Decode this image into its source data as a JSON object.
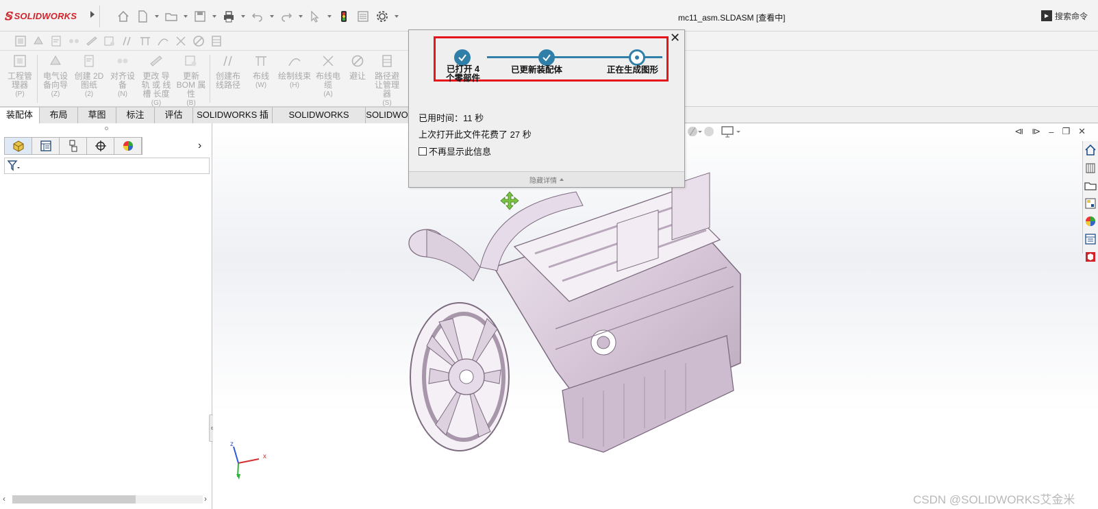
{
  "app": {
    "logo_mark": "𝕊",
    "logo_text": "SOLIDWORKS",
    "document_title": "mc11_asm.SLDASM [查看中]",
    "search_label": "搜索命令",
    "search_icon_glyph": "▶"
  },
  "command_manager": {
    "items": [
      {
        "label": "工程管理器",
        "shortcut": "(P)"
      },
      {
        "label": "电气设备向导",
        "shortcut": "(Z)"
      },
      {
        "label": "创建 2D 图纸",
        "shortcut": "(2)"
      },
      {
        "label": "对齐设备",
        "shortcut": "(N)"
      },
      {
        "label": "更改 导轨 或 线槽 长度",
        "shortcut": "(G)"
      },
      {
        "label": "更新 BOM 属性",
        "shortcut": "(B)"
      },
      {
        "label": "创建布线路径",
        "shortcut": ""
      },
      {
        "label": "布线",
        "shortcut": "(W)"
      },
      {
        "label": "绘制线束",
        "shortcut": "(H)"
      },
      {
        "label": "布线电缆",
        "shortcut": "(A)"
      },
      {
        "label": "避让",
        "shortcut": ""
      },
      {
        "label": "路径避让管理器",
        "shortcut": "(S)"
      }
    ]
  },
  "tabs": [
    {
      "label": "装配体"
    },
    {
      "label": "布局"
    },
    {
      "label": "草图"
    },
    {
      "label": "标注"
    },
    {
      "label": "评估"
    },
    {
      "label": "SOLIDWORKS 插件"
    },
    {
      "label": "SOLIDWORKS Visualize"
    },
    {
      "label": "SOLIDWO"
    }
  ],
  "left_panel": {
    "more_glyph": "›"
  },
  "dialog": {
    "close_glyph": "✕",
    "steps": [
      {
        "label": "已打开 4 个零部件",
        "status": "done"
      },
      {
        "label": "已更新装配体",
        "status": "done"
      },
      {
        "label": "正在生成图形",
        "status": "current"
      }
    ],
    "elapsed_label": "已用时间：",
    "elapsed_value": "11 秒",
    "last_open_text": "上次打开此文件花费了",
    "last_open_value": "27 秒",
    "dont_show_label": "不再显示此信息",
    "hide_details_label": "隐藏详情"
  },
  "triad": {
    "x": "x",
    "z": "z"
  },
  "watermark": "CSDN @SOLIDWORKS艾金米",
  "colors": {
    "brand_red": "#d2232a",
    "step_blue": "#2f7fa8",
    "highlight_red": "#e8141c",
    "model_tint": "#d7c7d8"
  }
}
